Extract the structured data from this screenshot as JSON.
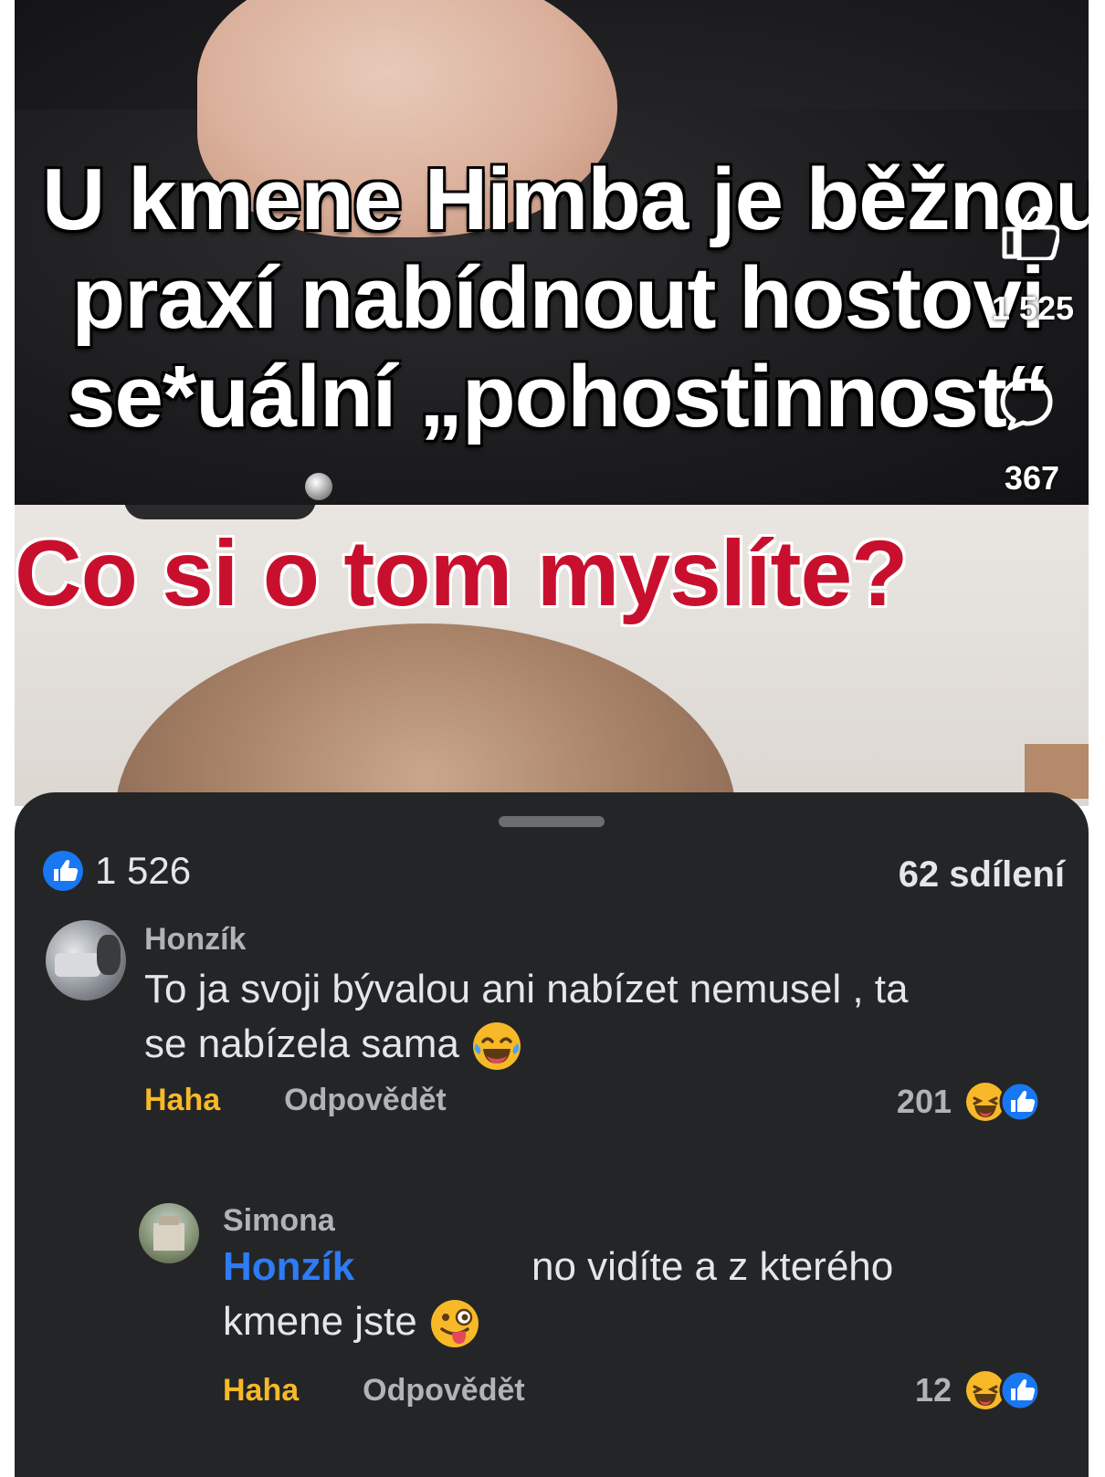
{
  "top_video": {
    "overlay_lines": [
      "U kmene Himba je běžnou",
      "praxí nabídnout hostovi",
      "se*uální „pohostinnost“"
    ],
    "like_count": "1 525",
    "comment_count": "367"
  },
  "second_video": {
    "caption": "Co si o tom myslíte?"
  },
  "post_stats": {
    "reaction_count": "1 526",
    "shares": "62 sdílení"
  },
  "comments": [
    {
      "author": "Honzík",
      "text_line1": "To ja svoji bývalou ani nabízet nemusel , ta",
      "text_line2": "se nabízela sama",
      "action_react": "Haha",
      "action_reply": "Odpovědět",
      "reaction_count": "201"
    },
    {
      "author": "Simona",
      "mention": "Honzík",
      "text_line1": "no vidíte a z kterého",
      "text_line2": "kmene jste",
      "action_react": "Haha",
      "action_reply": "Odpovědět",
      "reaction_count": "12"
    }
  ],
  "colors": {
    "sheet_bg": "#242526",
    "haha_yellow": "#f7b928",
    "like_blue": "#1877f2",
    "mention_blue": "#2e7bf6",
    "caption_red": "#c8102e"
  }
}
